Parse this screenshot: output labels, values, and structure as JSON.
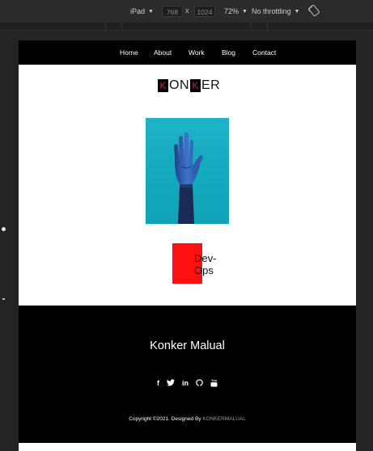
{
  "devtools": {
    "device": "iPad",
    "width": "768",
    "times": "x",
    "height": "1024",
    "zoom": "72%",
    "throttling": "No throttling"
  },
  "site": {
    "nav": [
      "Home",
      "About",
      "Work",
      "Blog",
      "Contact"
    ],
    "logo": {
      "letter1": "K",
      "part1": "ON",
      "letter2": "K",
      "part2": "ER"
    },
    "devops": [
      "Dev-",
      "Ops"
    ],
    "footer": {
      "name": "Konker Malual",
      "copyright_prefix": "Copyright ©2021. Designed By",
      "brand": "KONKERMALUAL",
      "socials": [
        "facebook-icon",
        "twitter-icon",
        "linkedin-icon",
        "github-icon",
        "youtube-icon"
      ]
    }
  },
  "colors": {
    "accent": "#ff1010",
    "hero_bg": "#12a9bd",
    "nav_bg": "#000000"
  }
}
